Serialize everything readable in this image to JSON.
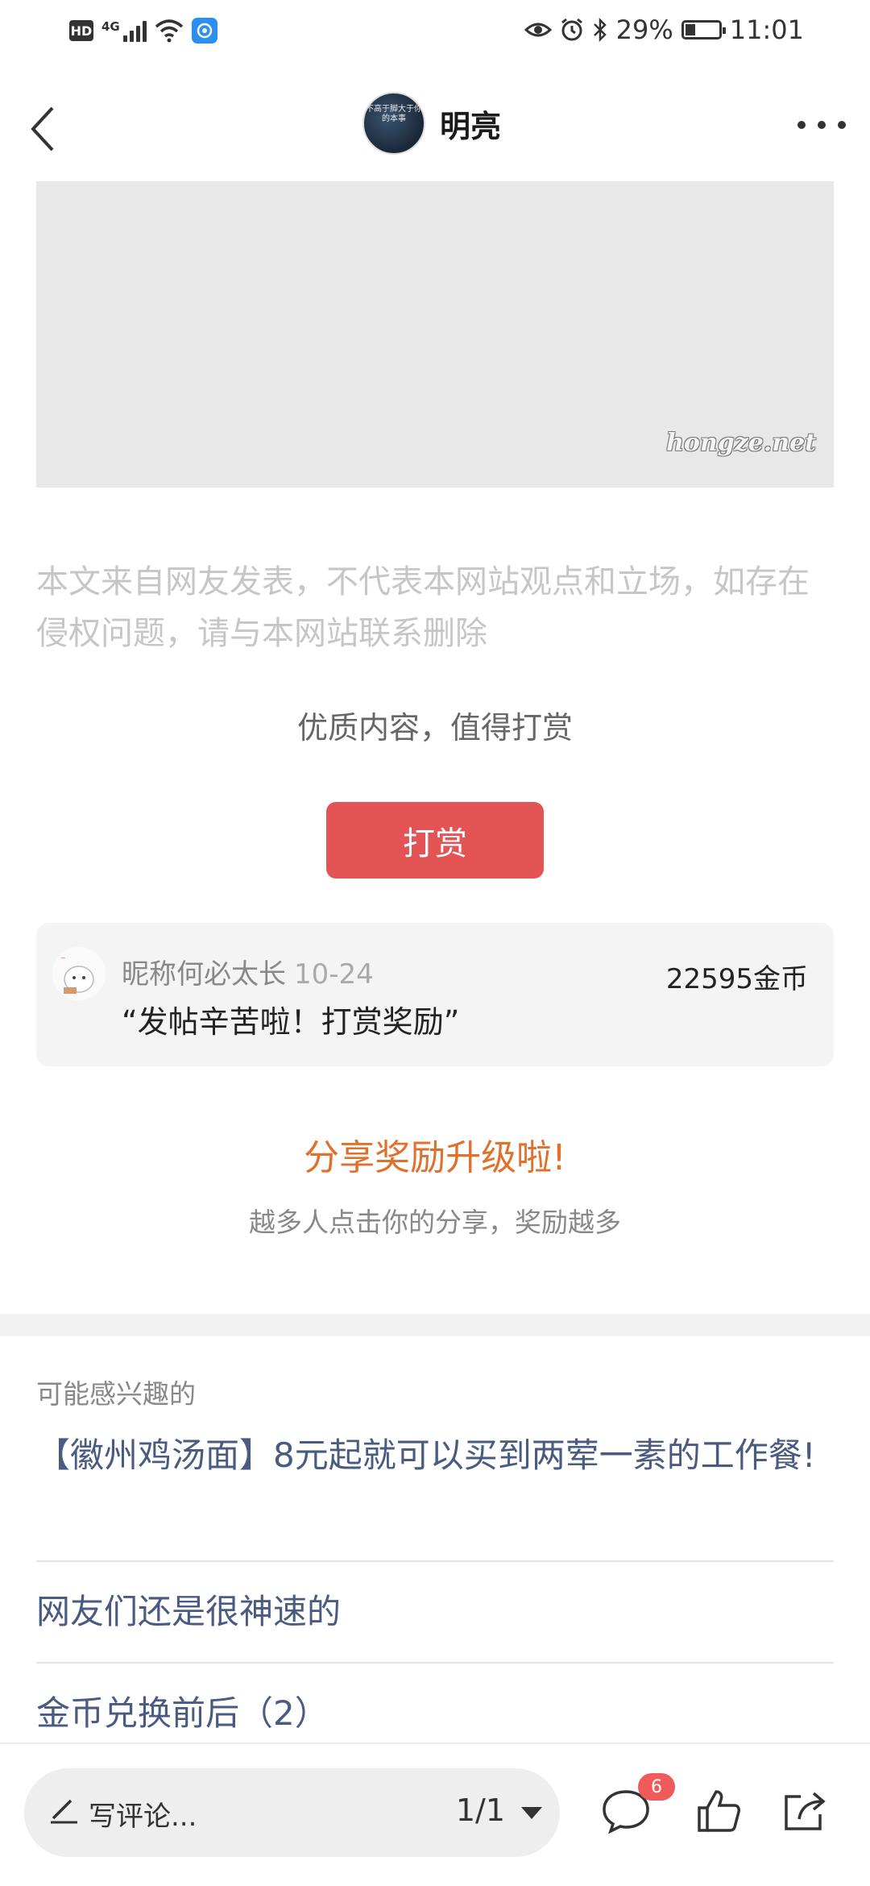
{
  "status_bar": {
    "hd": "HD",
    "network": "4G",
    "battery": "29%",
    "time": "11:01"
  },
  "header": {
    "title": "明亮",
    "avatar_text": "不高于脚大于你的本事"
  },
  "post": {
    "watermark": "hongze.net",
    "disclaimer": "本文来自网友发表，不代表本网站观点和立场，如存在侵权问题，请与本网站联系删除"
  },
  "reward": {
    "prompt": "优质内容，值得打赏",
    "button_label": "打赏",
    "record": {
      "nickname": "昵称何必太长",
      "date": "10-24",
      "message": "“发帖辛苦啦！打赏奖励”",
      "amount": "22595金币"
    }
  },
  "share": {
    "title": "分享奖励升级啦!",
    "subtitle": "越多人点击你的分享，奖励越多"
  },
  "related": {
    "header": "可能感兴趣的",
    "items": [
      "【徽州鸡汤面】8元起就可以买到两荤一素的工作餐!",
      "网友们还是很神速的",
      "金币兑换前后（2）"
    ]
  },
  "bottom_bar": {
    "comment_placeholder": "写评论...",
    "page": "1/1",
    "comment_count": "6"
  },
  "colors": {
    "reward_button": "#e55454",
    "share_title": "#e0702c",
    "related_link": "#4a5b82",
    "badge": "#f15a5a"
  },
  "icons": [
    "back-icon",
    "more-icon",
    "pen-icon",
    "dropdown-caret-icon",
    "comment-icon",
    "thumbs-up-icon",
    "share-icon"
  ]
}
